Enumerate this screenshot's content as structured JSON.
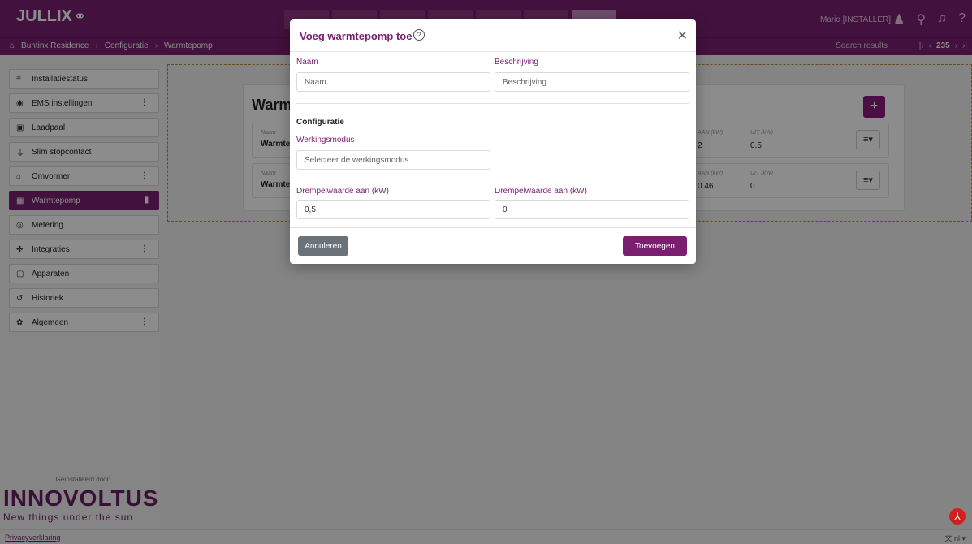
{
  "app": {
    "logo": "JULLIX",
    "user": "Mario [INSTALLER]"
  },
  "breadcrumb": {
    "items": [
      "Buntinx Residence",
      "Configuratie",
      "Warmtepomp"
    ],
    "search_results": "Search results",
    "page": "235"
  },
  "sidebar": {
    "items": [
      {
        "label": "Installatiestatus",
        "icon": "status-icon"
      },
      {
        "label": "EMS instellingen",
        "icon": "gauge-icon",
        "menu": true
      },
      {
        "label": "Laadpaal",
        "icon": "charger-icon"
      },
      {
        "label": "Slim stopcontact",
        "icon": "plug-icon"
      },
      {
        "label": "Omvormer",
        "icon": "home-icon",
        "menu": true
      },
      {
        "label": "Warmtepomp",
        "icon": "heatpump-icon",
        "active": true
      },
      {
        "label": "Metering",
        "icon": "meter-icon"
      },
      {
        "label": "Integraties",
        "icon": "puzzle-icon",
        "menu": true
      },
      {
        "label": "Apparaten",
        "icon": "devices-icon"
      },
      {
        "label": "Historiek",
        "icon": "history-icon"
      },
      {
        "label": "Algemeen",
        "icon": "gear-icon",
        "menu": true
      }
    ],
    "installed_by": "Geïnstalleerd door:",
    "brand": "INNOVOLTUS",
    "tagline": "New things under the sun"
  },
  "footer": {
    "privacy": "Privacyverklaring",
    "lang": "nl"
  },
  "card": {
    "title": "Warm",
    "rows": [
      {
        "name_label": "Naam",
        "name": "Warmte",
        "on_label": "AAN (kW)",
        "on": "2",
        "off_label": "UIT (kW)",
        "off": "0.5"
      },
      {
        "name_label": "Naam",
        "name": "Warmte",
        "on_label": "AAN (kW)",
        "on": "0.46",
        "off_label": "UIT (kW)",
        "off": "0"
      }
    ]
  },
  "modal": {
    "title": "Voeg warmtepomp toe",
    "name_label": "Naam",
    "name_placeholder": "Naam",
    "desc_label": "Beschrijving",
    "desc_placeholder": "Beschrijving",
    "section_title": "Configuratie",
    "mode_label": "Werkingsmodus",
    "mode_placeholder": "Selecteer de werkingsmodus",
    "threshold_on_label": "Drempelwaarde aan (kW)",
    "threshold_on_value": "0,5",
    "threshold_off_label": "Drempelwaarde aan (kW)",
    "threshold_off_value": "0",
    "cancel_label": "Annuleren",
    "submit_label": "Toevoegen"
  },
  "colors": {
    "brand": "#7a1f6f",
    "overlay": "rgba(0,0,0,0.45)"
  }
}
